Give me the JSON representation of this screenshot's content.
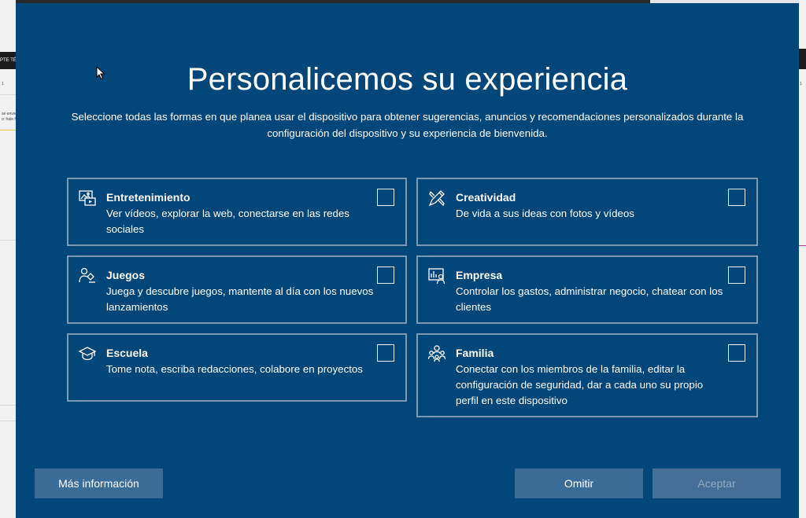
{
  "background": {
    "left_strip_text": "PTE TÉC",
    "left_row_texts": [
      "1",
      "se envíe tu",
      "o: hale fi..."
    ],
    "right_marker": "1"
  },
  "dialog": {
    "title": "Personalicemos su experiencia",
    "subtitle": "Seleccione todas las formas en que planea usar el dispositivo para obtener sugerencias, anuncios y recomendaciones personalizados durante la configuración del dispositivo y su experiencia de bienvenida.",
    "options": [
      {
        "title": "Entretenimiento",
        "description": "Ver vídeos, explorar la web, conectarse en las redes sociales",
        "icon": "entertainment-icon",
        "checked": false
      },
      {
        "title": "Creatividad",
        "description": "De vida a sus ideas con fotos y vídeos",
        "icon": "creativity-icon",
        "checked": false
      },
      {
        "title": "Juegos",
        "description": "Juega y descubre juegos, mantente al día con los nuevos lanzamientos",
        "icon": "gaming-icon",
        "checked": false
      },
      {
        "title": "Empresa",
        "description": "Controlar los gastos, administrar negocio, chatear con los clientes",
        "icon": "business-icon",
        "checked": false
      },
      {
        "title": "Escuela",
        "description": "Tome nota, escriba redacciones, colabore en proyectos",
        "icon": "school-icon",
        "checked": false
      },
      {
        "title": "Familia",
        "description": "Conectar con los miembros de la familia, editar la configuración de seguridad, dar a cada uno su propio perfil en este dispositivo",
        "icon": "family-icon",
        "checked": false
      }
    ],
    "buttons": {
      "more_info": "Más información",
      "skip": "Omitir",
      "accept": "Aceptar"
    }
  },
  "colors": {
    "dialog_background": "#03467a",
    "card_border": "#7b9ab7",
    "button_background": "#3b6b97",
    "button_disabled_text": "#8fa9c3"
  }
}
